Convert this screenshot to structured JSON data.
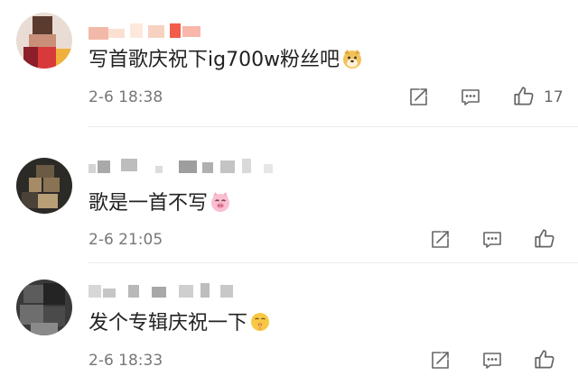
{
  "comments": [
    {
      "text": "写首歌庆祝下ig700w粉丝吧",
      "emoji": "doge-emoji",
      "time": "2-6 18:38",
      "likes": "17"
    },
    {
      "text": "歌是一首不写",
      "emoji": "pig-face-emoji",
      "time": "2-6 21:05",
      "likes": ""
    },
    {
      "text": "发个专辑庆祝一下",
      "emoji": "shushing-face-emoji",
      "time": "2-6 18:33",
      "likes": ""
    }
  ],
  "icons": {
    "share": "share-icon",
    "reply": "comment-icon",
    "like": "thumbs-up-icon"
  },
  "colors": {
    "text": "#222222",
    "meta": "#777777",
    "icon": "#666666",
    "divider": "#ececec"
  }
}
